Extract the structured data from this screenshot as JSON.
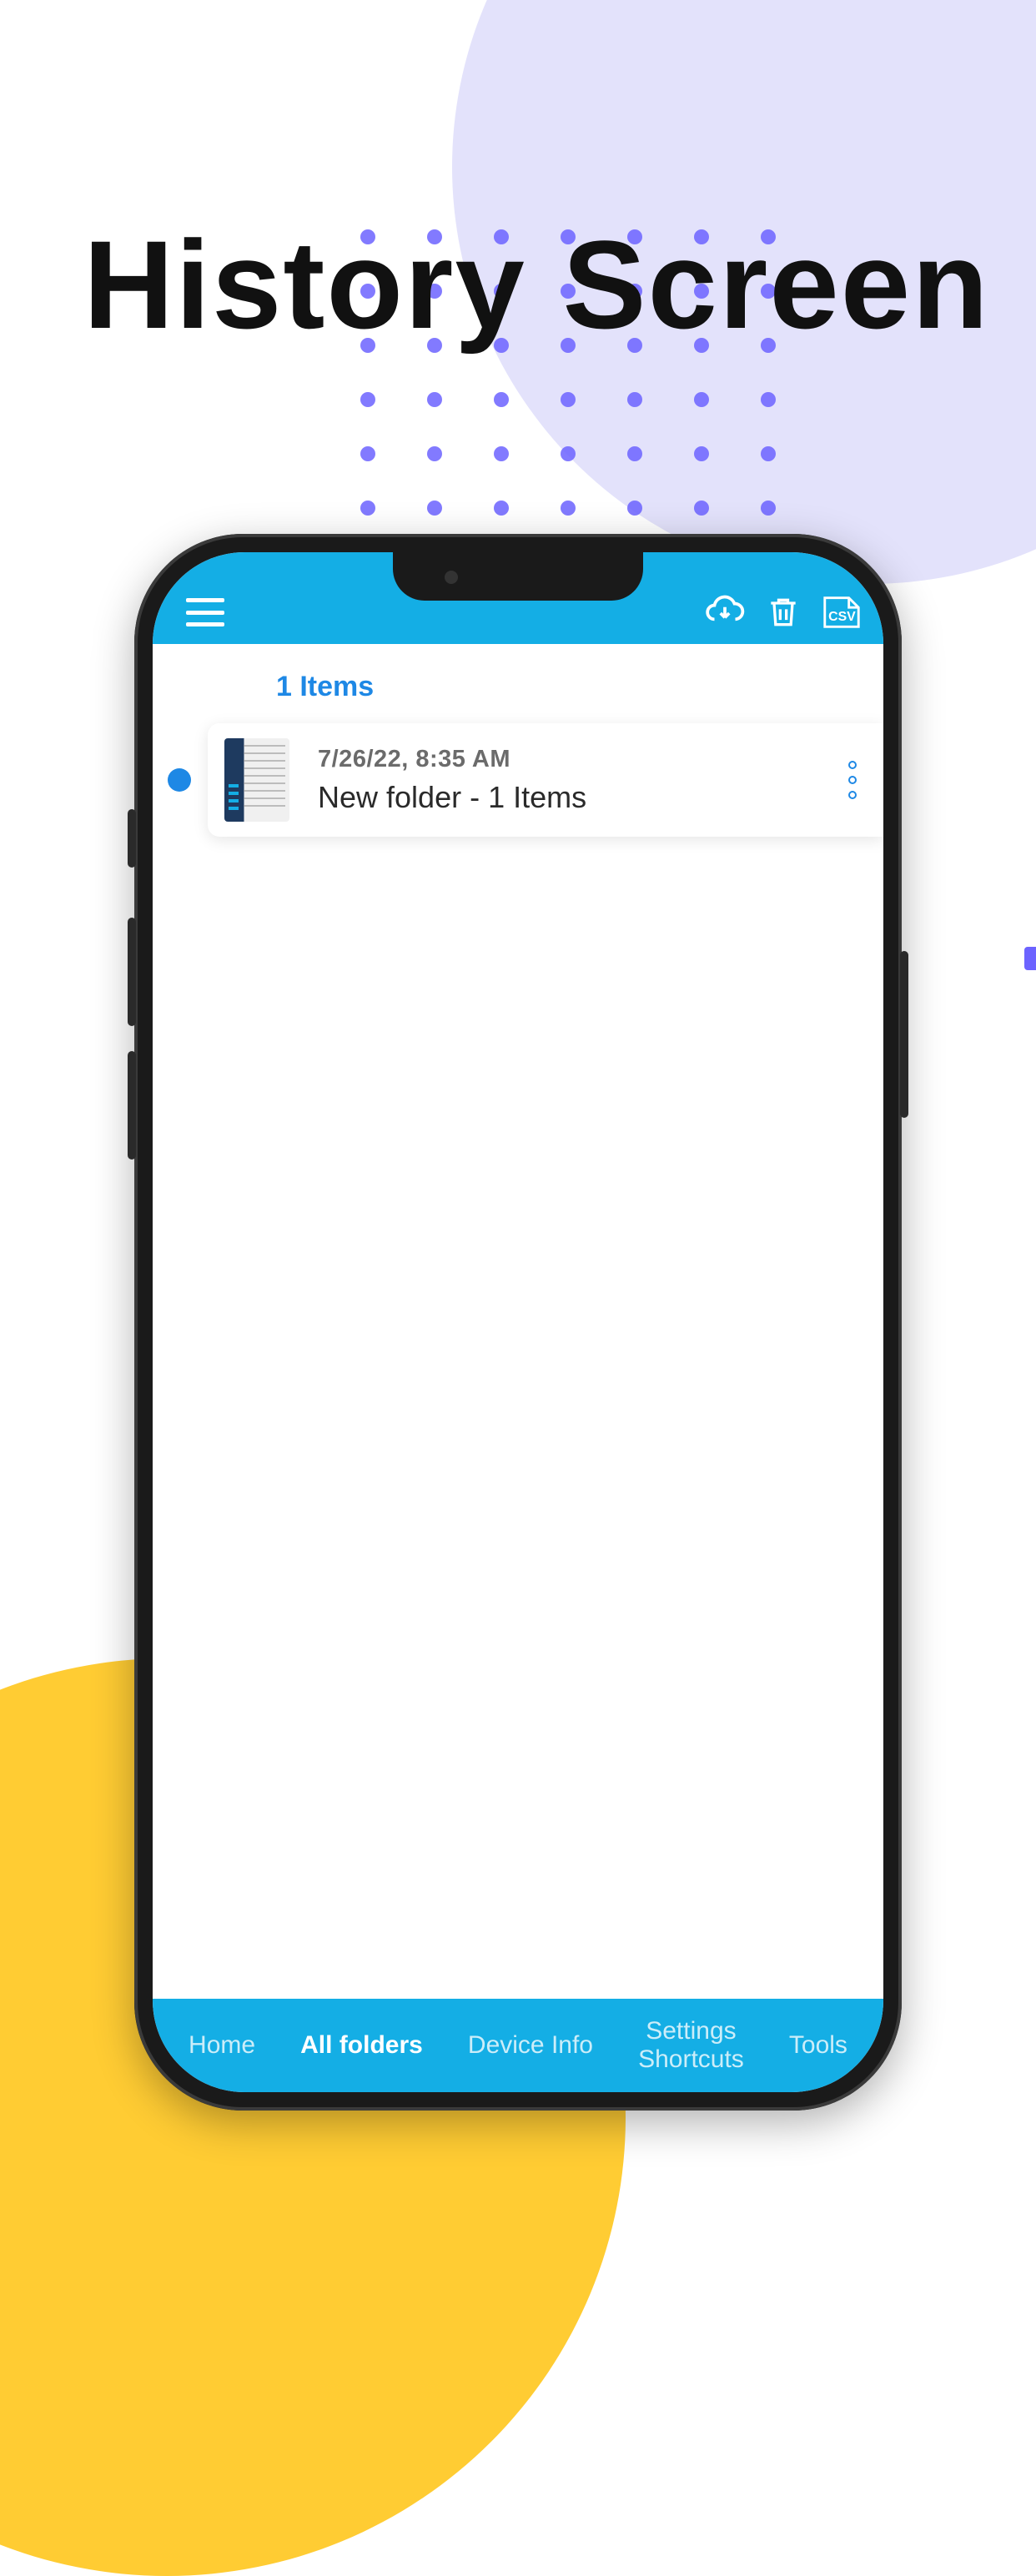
{
  "page_heading": "History Screen",
  "header": {
    "icons": {
      "menu": "menu",
      "cloud_download": "cloud-download",
      "trash": "trash",
      "csv": "CSV"
    }
  },
  "content": {
    "items_count_label": "1 Items",
    "rows": [
      {
        "date": "7/26/22, 8:35 AM",
        "title": "New folder - 1 Items"
      }
    ]
  },
  "tabs": {
    "home": "Home",
    "all_folders": "All folders",
    "device_info": "Device Info",
    "settings_line1": "Settings",
    "settings_line2": "Shortcuts",
    "tools": "Tools"
  },
  "colors": {
    "accent": "#14AEE5",
    "link": "#1E88E5",
    "blob_top": "#E3E2FB",
    "blob_bottom": "#FFCC33",
    "dot": "#6C63FF"
  }
}
